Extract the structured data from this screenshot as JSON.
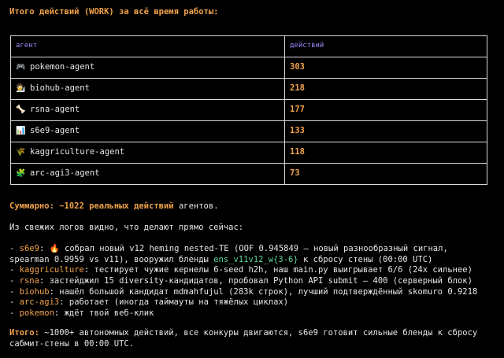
{
  "heading": "Итого действий (WORK) за всё время работы:",
  "table": {
    "headers": [
      "агент",
      "действий"
    ],
    "rows": [
      {
        "icon": "🎮",
        "icon_name": "game-controller-icon",
        "agent": "pokemon-agent",
        "count": "303"
      },
      {
        "icon": "🧑‍🔬",
        "icon_name": "scientist-icon",
        "agent": "biohub-agent",
        "count": "218"
      },
      {
        "icon": "🦴",
        "icon_name": "bone-icon",
        "agent": "rsna-agent",
        "count": "177"
      },
      {
        "icon": "📊",
        "icon_name": "bar-chart-icon",
        "agent": "s6e9-agent",
        "count": "133"
      },
      {
        "icon": "🌾",
        "icon_name": "wheat-icon",
        "agent": "kaggriculture-agent",
        "count": "118"
      },
      {
        "icon": "🧩",
        "icon_name": "puzzle-icon",
        "agent": "arc-agi3-agent",
        "count": "73"
      }
    ]
  },
  "summary": {
    "label": "Суммарно: ~1022 реальных действий",
    "rest": " агентов."
  },
  "intro": "Из свежих логов видно, что делают прямо сейчас:",
  "log": {
    "s6e9": {
      "name": "s6e9",
      "icon": "🔥",
      "text1": " собрал новый v12 heming nested-TE (OOF 0.945849 — новый разнообразный сигнал,",
      "text2a": "  spearman 0.9959 vs v11), вооружил бленды ",
      "code": "ens_v11v12_w{3-6}",
      "text2b": " к сбросу стены (00:00 UTC)"
    },
    "kaggriculture": {
      "name": "kaggriculture",
      "text": " тестирует чужие кернелы 6-seed h2h, наш main.py выигрывает 6/6 (24x сильнее)"
    },
    "rsna": {
      "name": "rsna",
      "text": " застейджил 15 diversity-кандидатов, пробовал Python API submit — 400 (серверный блок)"
    },
    "biohub": {
      "name": "biohub",
      "text": " нашёл большой кандидат mdmahfujul (283k строк), лучший подтверждённый skomuro 0.9218"
    },
    "arcagi3": {
      "name": "arc-agi3",
      "text": " работает (иногда таймауты на тяжёлых циклах)"
    },
    "pokemon": {
      "name": "pokemon",
      "text": " ждёт твой веб-клик"
    }
  },
  "final": {
    "label": "Итого:",
    "line1": " ~1000+ автономных действий, все конкуры двигаются, s6e9 готовит сильные бленды к сбросу",
    "line2": "сабмит-стены в 00:00 UTC."
  }
}
